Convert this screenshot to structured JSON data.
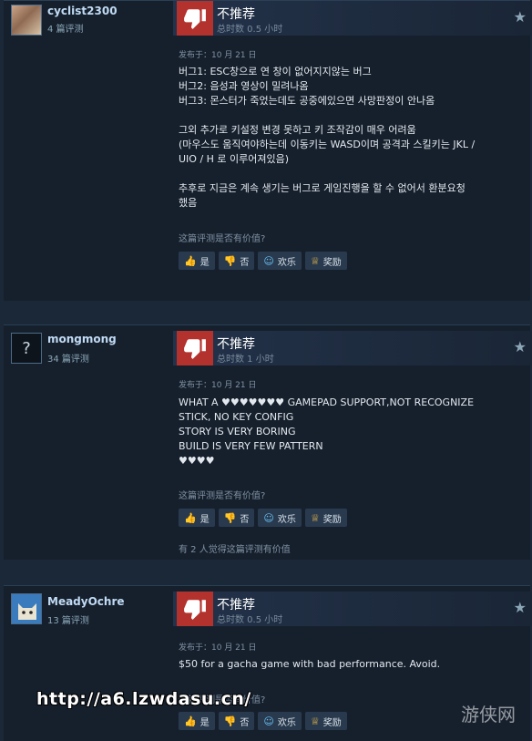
{
  "reviews": [
    {
      "author": "cyclist2300",
      "review_count": "4 篇评测",
      "verdict": "不推荐",
      "hours": "总时数 0.5 小时",
      "posted": "发布于：10 月 21 日",
      "body": [
        "버그1: ESC창으로 연 창이 없어지지않는 버그",
        "버그2: 음성과 영상이 밀려나옴",
        "버그3: 몬스터가 죽었는데도 공중에있으면 사망판정이 안나옴",
        "",
        "그외 추가로 키설정 변경 못하고 키 조작감이 매우 어려움",
        "(마우스도 움직여야하는데 이동키는 WASD이며 공격과 스킬키는 JKL /",
        "UIO / H 로 이루어져있음)",
        "",
        "추후로 지금은 계속 생기는 버그로 게임진행을 할 수 없어서 환분요청",
        "했음"
      ],
      "helpful_question": "这篇评测是否有价值?",
      "found_helpful": ""
    },
    {
      "author": "mongmong",
      "review_count": "34 篇评测",
      "verdict": "不推荐",
      "hours": "总时数 1 小时",
      "posted": "发布于：10 月 21 日",
      "body": [
        "WHAT A ♥♥♥♥♥♥♥ GAMEPAD SUPPORT,NOT RECOGNIZE",
        "STICK, NO KEY CONFIG",
        "STORY IS VERY BORING",
        "BUILD IS VERY FEW PATTERN",
        "♥♥♥♥"
      ],
      "helpful_question": "这篇评测是否有价值?",
      "found_helpful": "有 2 人觉得这篇评测有价值"
    },
    {
      "author": "MeadyOchre",
      "review_count": "13 篇评测",
      "verdict": "不推荐",
      "hours": "总时数 0.5 小时",
      "posted": "发布于：10 月 21 日",
      "body": [
        "$50 for a gacha game with bad performance. Avoid."
      ],
      "helpful_question": "这篇评测是否有价值?",
      "found_helpful": ""
    }
  ],
  "buttons": {
    "yes": "是",
    "no": "否",
    "funny": "欢乐",
    "award": "奖励"
  },
  "watermark": {
    "url": "http://a6.lzwdasu.cn/",
    "logo": "游侠网"
  },
  "colors": {
    "background": "#1b2838",
    "card": "#16202d",
    "thumb_down": "#b3322e",
    "author_name": "#c1dbf4"
  },
  "icons": {
    "thumb_down": "thumbs-down-icon",
    "star": "star-icon",
    "thumb_up": "thumbs-up-icon",
    "funny": "smiley-icon",
    "award": "award-icon"
  }
}
